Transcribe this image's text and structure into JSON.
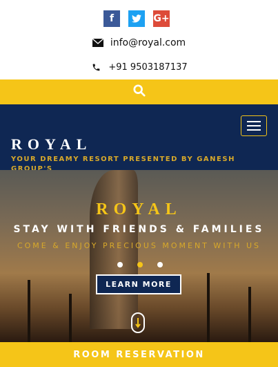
{
  "social": {
    "facebook": "f",
    "twitter": "t",
    "google_plus": "G+"
  },
  "contact": {
    "email": "info@royal.com",
    "phone": "+91 9503187137"
  },
  "nav": {
    "brand": "ROYAL",
    "tagline": "YOUR DREAMY RESORT PRESENTED BY GANESH GROUP'S"
  },
  "hero": {
    "title": "ROYAL",
    "subtitle": "STAY WITH FRIENDS & FAMILIES",
    "subtitle2": "COME & ENJOY PRECIOUS MOMENT WITH US",
    "cta": "LEARN MORE"
  },
  "reservation": {
    "label": "ROOM RESERVATION"
  },
  "colors": {
    "accent": "#f5c518",
    "navy": "#0f2753",
    "gold_text": "#d8a92a"
  },
  "icons": [
    "facebook-icon",
    "twitter-icon",
    "google-plus-icon",
    "envelope-icon",
    "phone-icon",
    "search-icon",
    "menu-icon",
    "scroll-down-icon"
  ]
}
